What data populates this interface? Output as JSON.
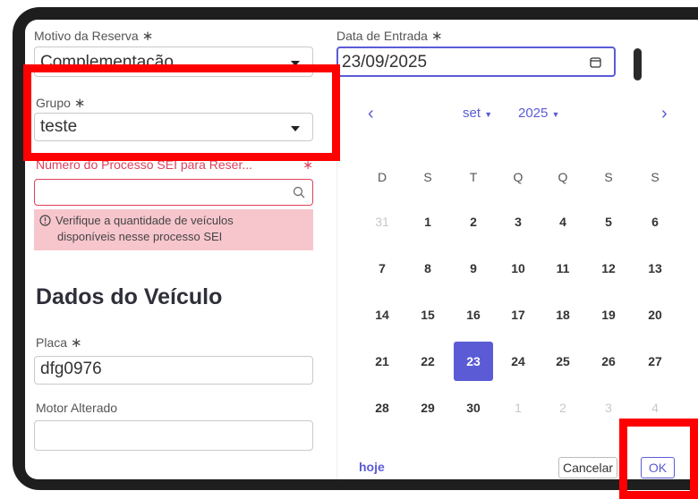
{
  "form": {
    "motivo": {
      "label": "Motivo da Reserva",
      "required": "∗",
      "value": "Complementação"
    },
    "data_entrada": {
      "label": "Data de Entrada",
      "required": "∗",
      "value": "23/09/2025"
    },
    "grupo": {
      "label": "Grupo",
      "required": "∗",
      "value": "teste"
    },
    "processo": {
      "label": "Número do Processo SEI para Reser...",
      "required": "∗",
      "value": ""
    },
    "warning": {
      "line1": "Verifique a quantidade de veículos",
      "line2": "disponíveis nesse processo SEI",
      "icon": "info-circle-icon"
    },
    "section_title": "Dados do Veículo",
    "placa": {
      "label": "Placa",
      "required": "∗",
      "value": "dfg0976"
    },
    "motor": {
      "label": "Motor Alterado",
      "value": ""
    }
  },
  "calendar": {
    "prev": "‹",
    "next": "›",
    "month": "set",
    "year": "2025",
    "weekdays": [
      "D",
      "S",
      "T",
      "Q",
      "Q",
      "S",
      "S"
    ],
    "weeks": [
      [
        "31",
        "1",
        "2",
        "3",
        "4",
        "5",
        "6"
      ],
      [
        "7",
        "8",
        "9",
        "10",
        "11",
        "12",
        "13"
      ],
      [
        "14",
        "15",
        "16",
        "17",
        "18",
        "19",
        "20"
      ],
      [
        "21",
        "22",
        "23",
        "24",
        "25",
        "26",
        "27"
      ],
      [
        "28",
        "29",
        "30",
        "1",
        "2",
        "3",
        "4"
      ]
    ],
    "muted": [
      [
        0,
        0
      ],
      [
        4,
        3
      ],
      [
        4,
        4
      ],
      [
        4,
        5
      ],
      [
        4,
        6
      ]
    ],
    "selected": [
      3,
      2
    ],
    "today_label": "hoje",
    "cancel_label": "Cancelar",
    "ok_label": "OK"
  },
  "colors": {
    "accent": "#5b5bd6",
    "error": "#e0405a",
    "warning_bg": "#f7c6cc",
    "highlight": "#ff0000"
  }
}
